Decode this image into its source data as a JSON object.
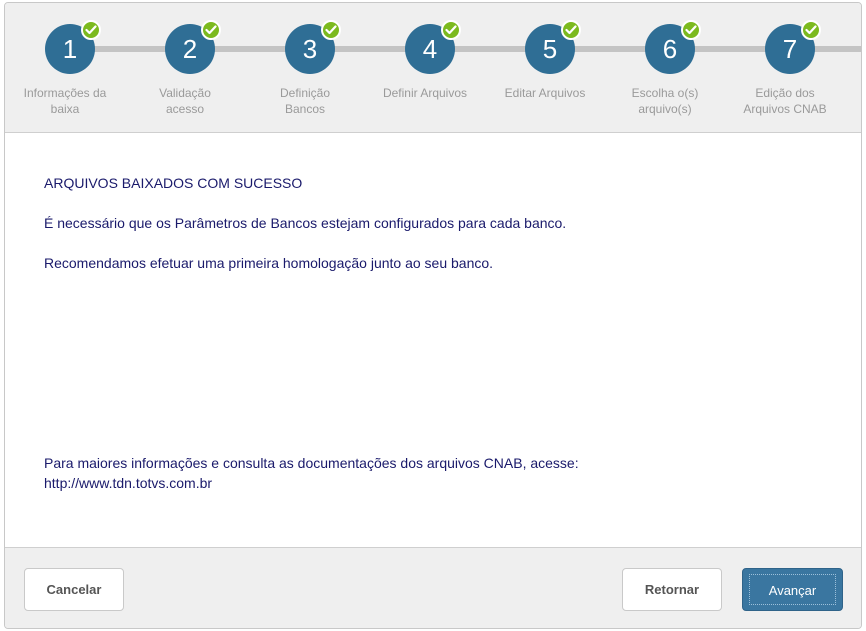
{
  "stepper": {
    "steps": [
      {
        "number": "1",
        "label": "Informações da\nbaixa"
      },
      {
        "number": "2",
        "label": "Validação\nacesso"
      },
      {
        "number": "3",
        "label": "Definição\nBancos"
      },
      {
        "number": "4",
        "label": "Definir Arquivos"
      },
      {
        "number": "5",
        "label": "Editar Arquivos"
      },
      {
        "number": "6",
        "label": "Escolha o(s)\narquivo(s)"
      },
      {
        "number": "7",
        "label": "Edição dos\nArquivos CNAB"
      }
    ],
    "check_icon": "check-icon",
    "colors": {
      "circle": "#2f6e95",
      "check": "#7cba1f"
    }
  },
  "content": {
    "title": "ARQUIVOS BAIXADOS COM SUCESSO",
    "line1": "É necessário que os Parâmetros de Bancos estejam configurados para cada banco.",
    "line2": "Recomendamos efetuar uma primeira homologação junto ao seu banco.",
    "info": "Para maiores informações e consulta as documentações dos arquivos CNAB, acesse:",
    "link": "http://www.tdn.totvs.com.br"
  },
  "footer": {
    "cancel_label": "Cancelar",
    "back_label": "Retornar",
    "next_label": "Avançar"
  }
}
